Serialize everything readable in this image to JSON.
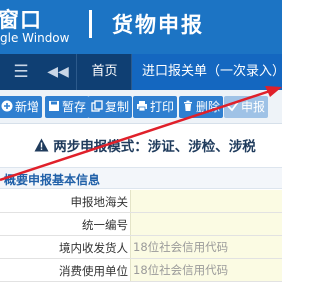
{
  "header": {
    "brand_cn": "窗口",
    "brand_en": "gle Window",
    "title": "货物申报"
  },
  "tabs": {
    "menu_icon": "hamburger-icon",
    "prev_icon": "double-chevron-left-icon",
    "home": "首页",
    "active": "进口报关单（一次录入）"
  },
  "toolbar": {
    "buttons": [
      {
        "icon": "plus-icon",
        "label": "新增"
      },
      {
        "icon": "save-icon",
        "label": "暂存"
      },
      {
        "icon": "copy-icon",
        "label": "复制"
      },
      {
        "icon": "print-icon",
        "label": "打印"
      },
      {
        "icon": "trash-icon",
        "label": "删除"
      },
      {
        "icon": "declare-icon",
        "label": "申报"
      }
    ]
  },
  "notice": {
    "icon": "warning-icon",
    "text": "两步申报模式：涉证、涉检、涉税"
  },
  "section": {
    "title": "概要申报基本信息"
  },
  "form": {
    "rows": [
      {
        "label": "申报地海关",
        "value": "",
        "placeholder": ""
      },
      {
        "label": "统一编号",
        "value": "",
        "placeholder": ""
      },
      {
        "label": "境内收发货人",
        "value": "",
        "placeholder": "18位社会信用代码"
      },
      {
        "label": "消费使用单位",
        "value": "",
        "placeholder": "18位社会信用代码"
      }
    ]
  },
  "colors": {
    "header_blue": "#1c74c4",
    "tabstrip_navy": "#0f3f73",
    "active_tab": "#1467c0",
    "button_blue": "#2f7fd0",
    "input_yellow": "#fbfbe3",
    "annotation_red": "#e0202a"
  }
}
